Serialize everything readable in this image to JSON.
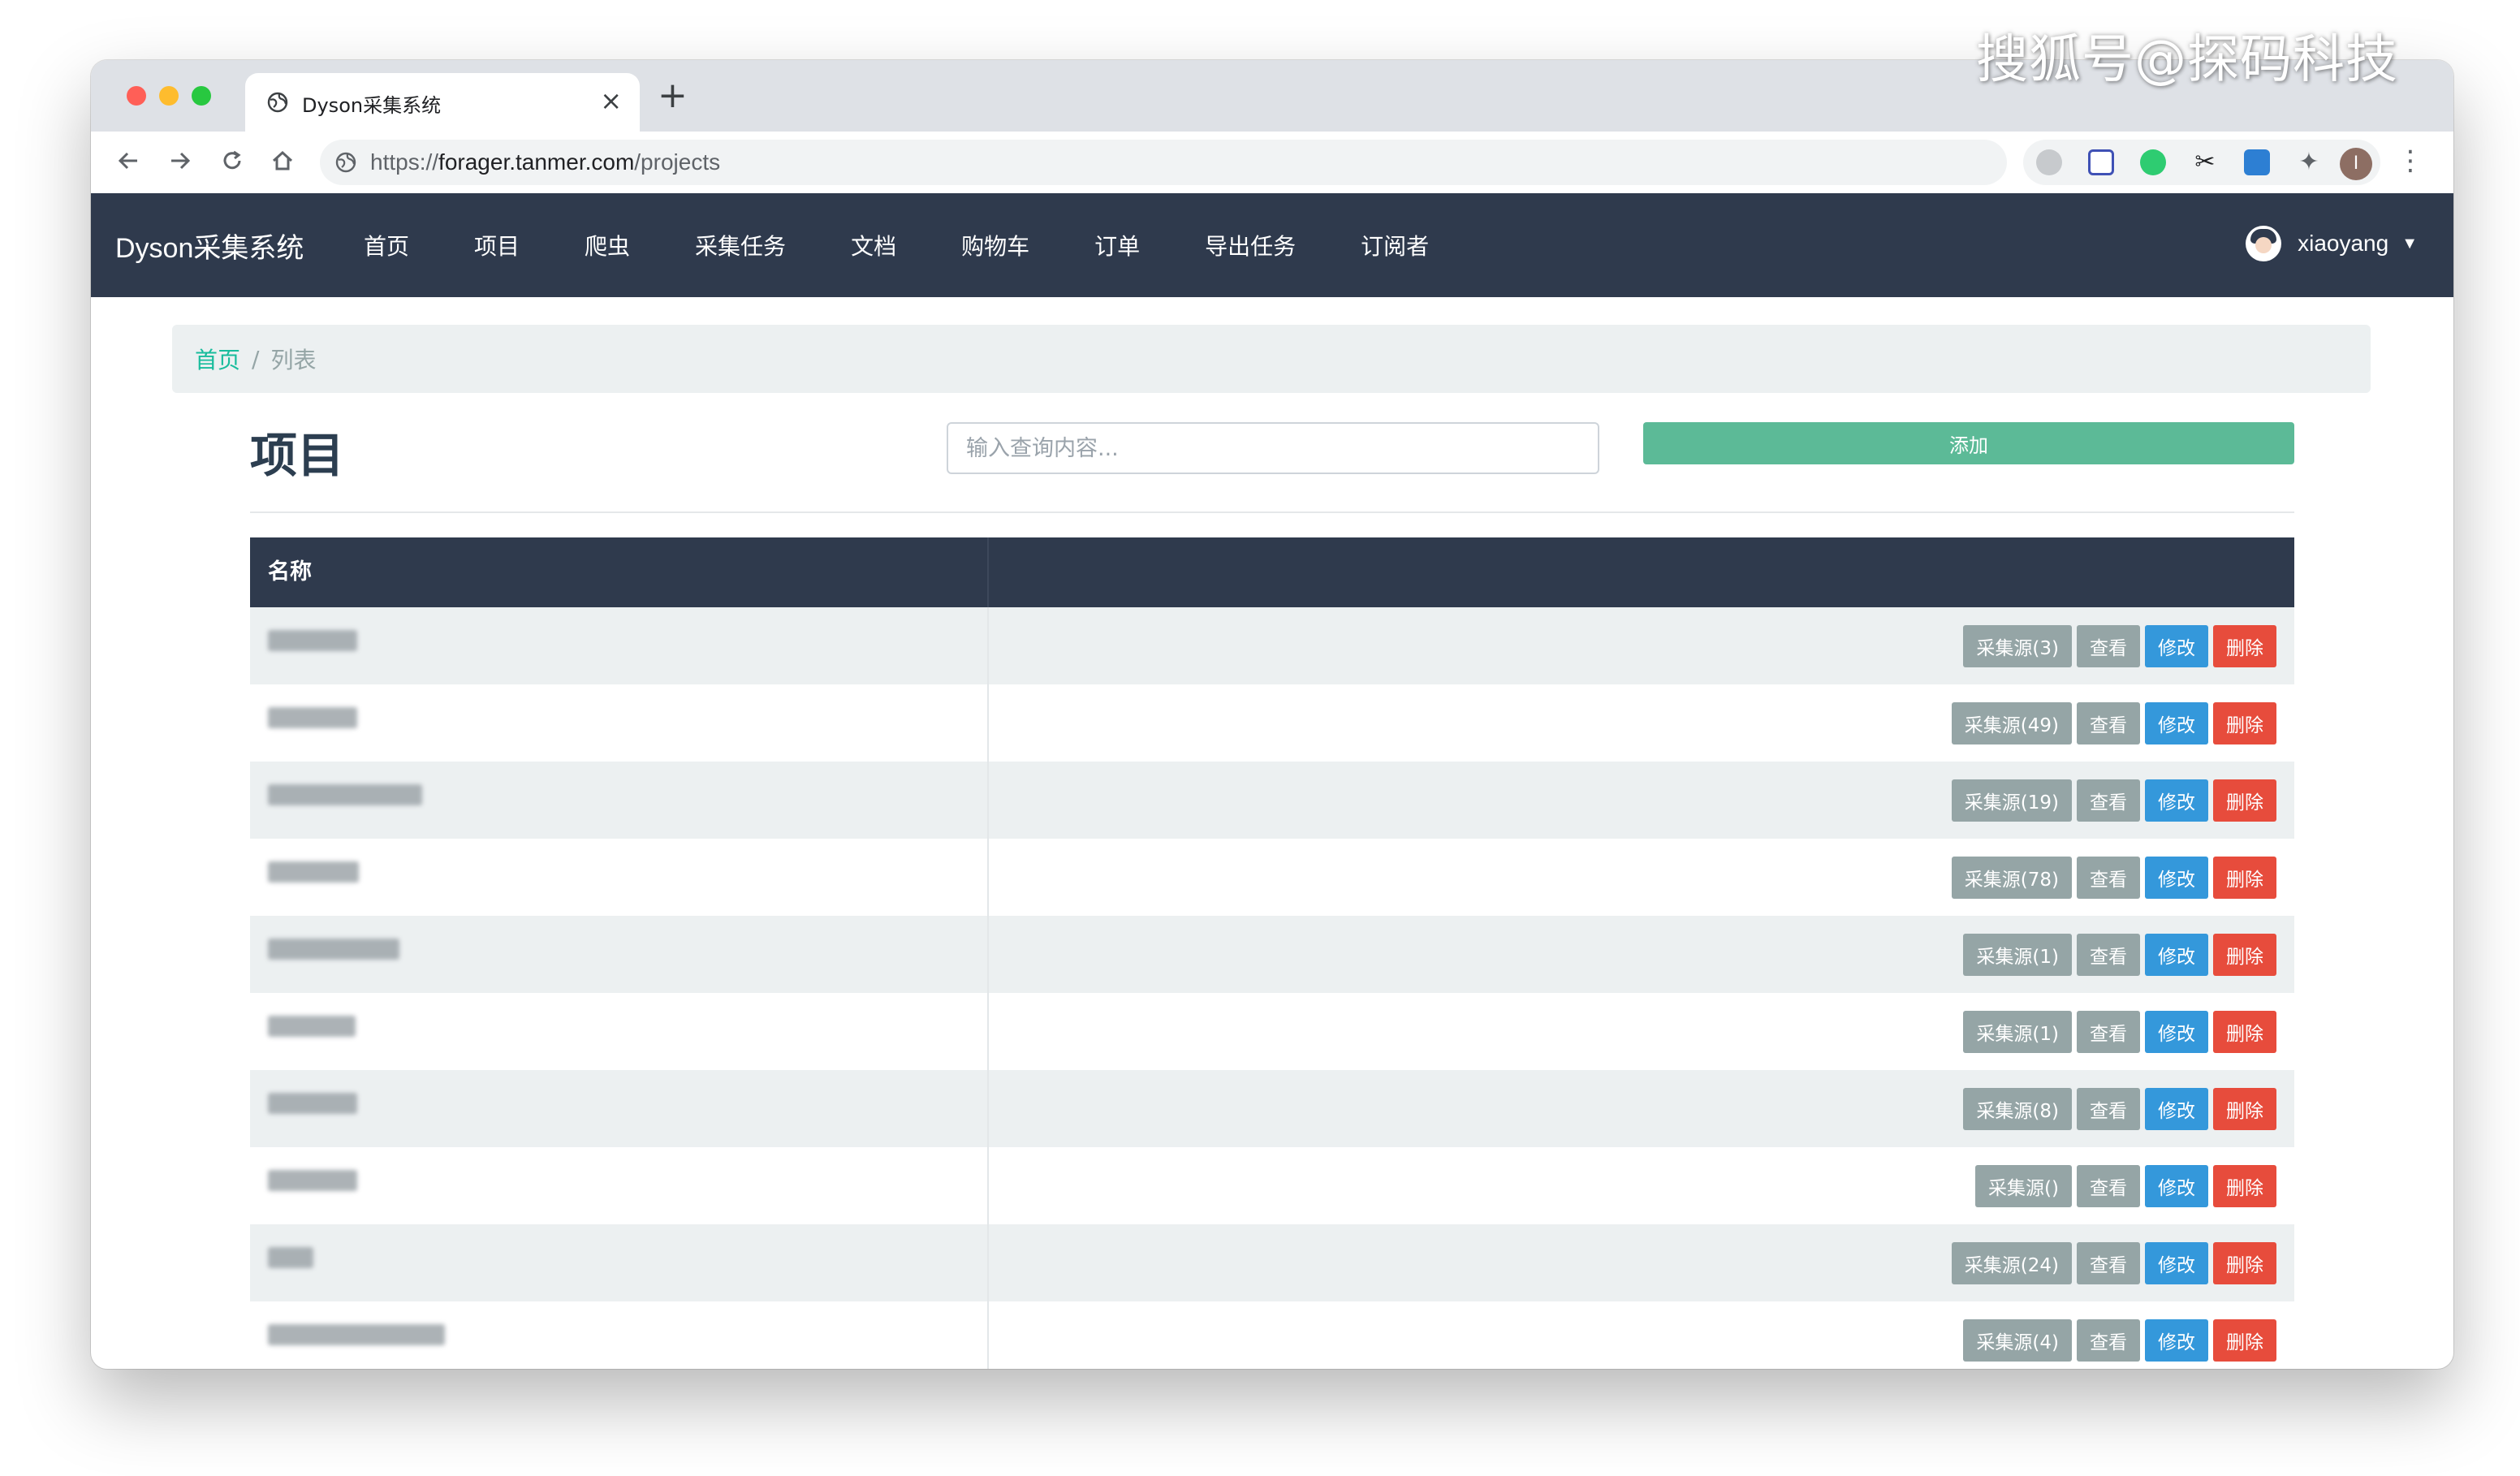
{
  "watermark": "搜狐号@探码科技",
  "browser": {
    "tab_title": "Dyson采集系统",
    "new_tab": "+",
    "close_tab": "×",
    "url_prefix": "https://",
    "url_host": "forager.tanmer.com",
    "url_path": "/projects",
    "profile_initial": "I"
  },
  "navbar": {
    "brand": "Dyson采集系统",
    "links": [
      "首页",
      "项目",
      "爬虫",
      "采集任务",
      "文档",
      "购物车",
      "订单",
      "导出任务",
      "订阅者"
    ],
    "user": "xiaoyang"
  },
  "breadcrumb": {
    "home": "首页",
    "sep": "/",
    "current": "列表"
  },
  "page": {
    "title": "项目",
    "search_placeholder": "输入查询内容...",
    "add_label": "添加"
  },
  "table": {
    "header_name": "名称",
    "buttons": {
      "view": "查看",
      "edit": "修改",
      "delete": "删除"
    },
    "rows": [
      {
        "source_label": "采集源(3)"
      },
      {
        "source_label": "采集源(49)"
      },
      {
        "source_label": "采集源(19)"
      },
      {
        "source_label": "采集源(78)"
      },
      {
        "source_label": "采集源(1)"
      },
      {
        "source_label": "采集源(1)"
      },
      {
        "source_label": "采集源(8)"
      },
      {
        "source_label": "采集源()"
      },
      {
        "source_label": "采集源(24)"
      },
      {
        "source_label": "采集源(4)"
      }
    ]
  }
}
